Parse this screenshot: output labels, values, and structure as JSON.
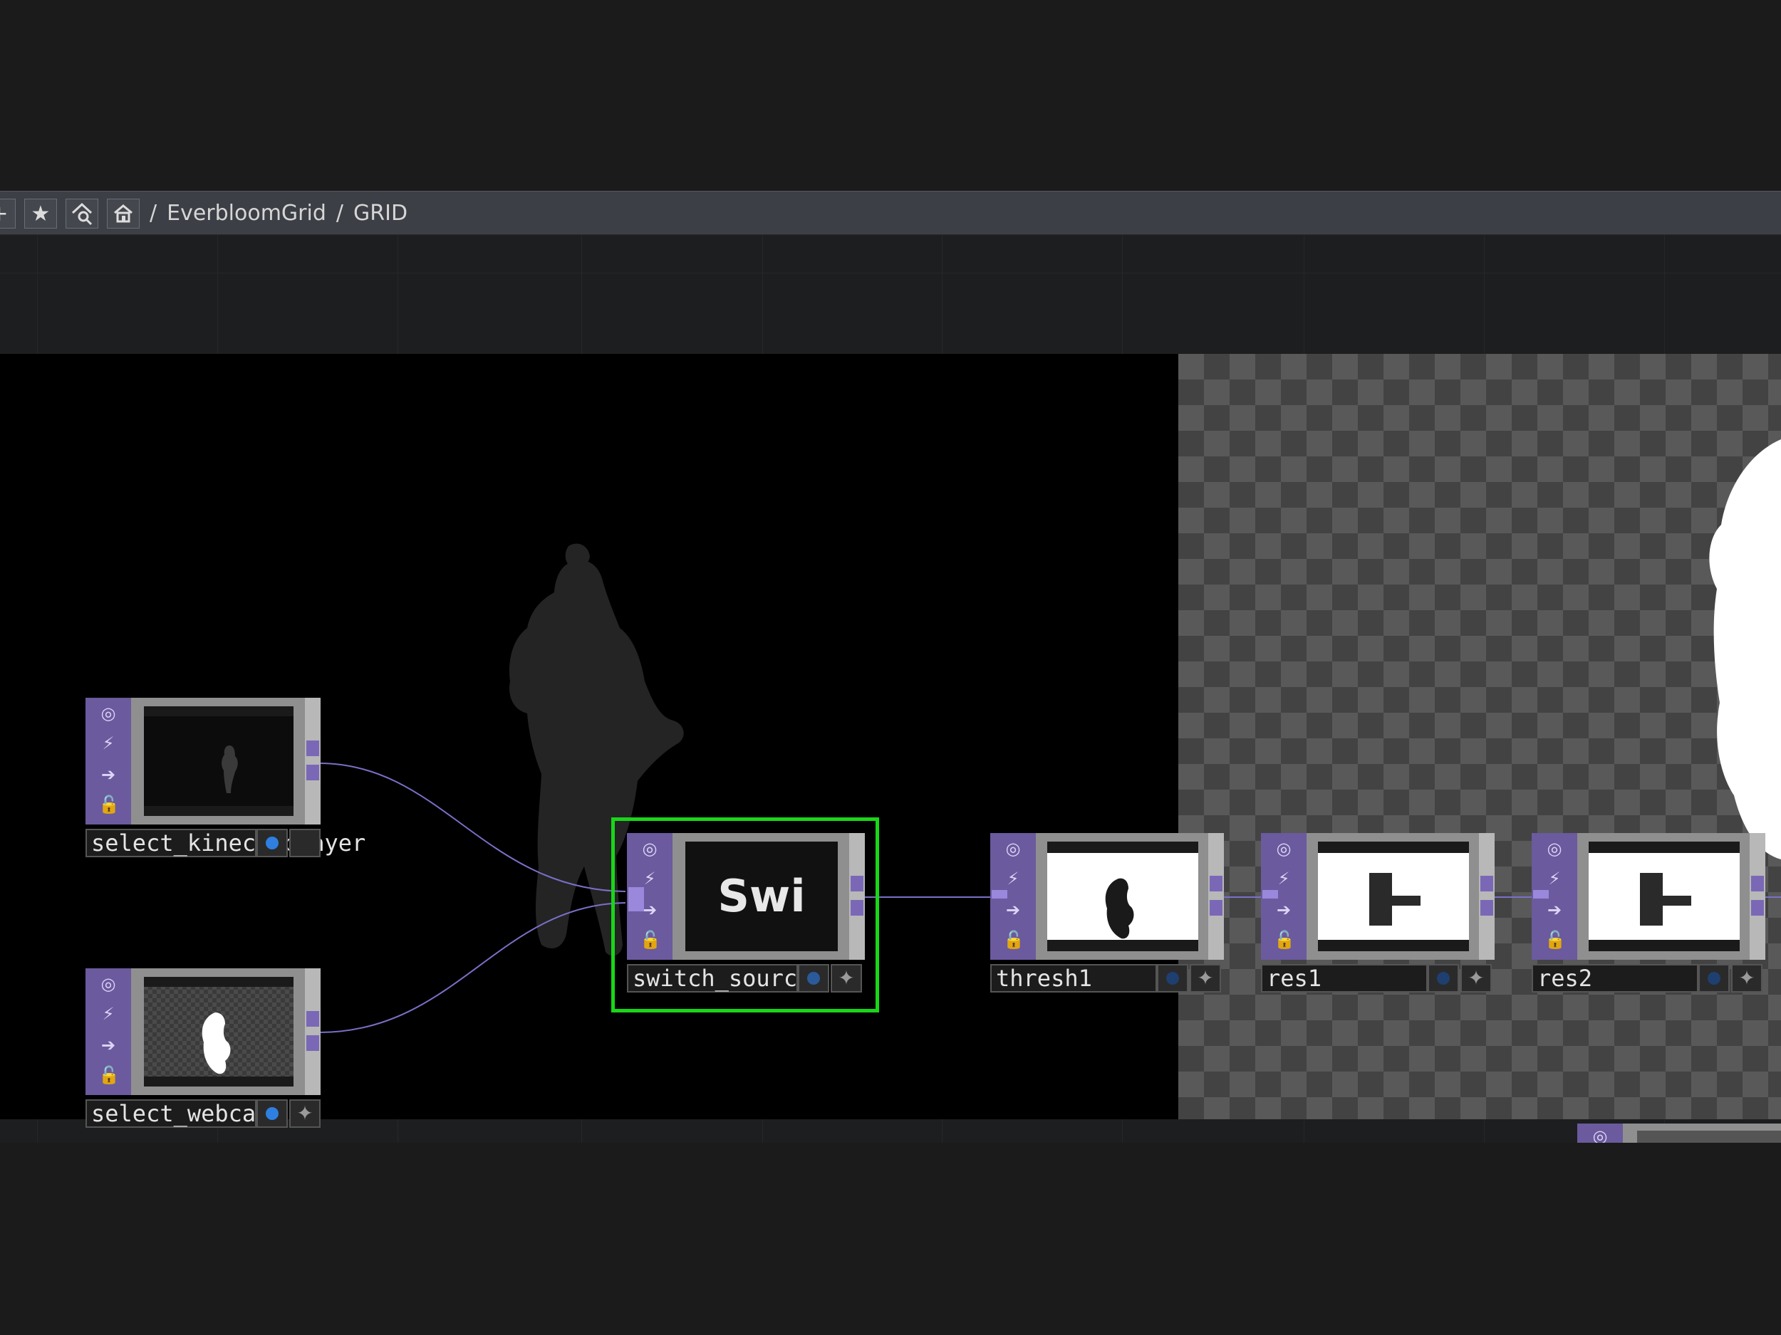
{
  "toolbar": {
    "breadcrumb": [
      "/",
      "EverbloomGrid",
      "/",
      "GRID"
    ],
    "buttons": [
      "plus-icon",
      "star-icon",
      "search-network-icon",
      "home-icon"
    ]
  },
  "nodes": {
    "select_kinect_player": {
      "label": "select_kinect_player"
    },
    "select_webcam": {
      "label": "select_webcam"
    },
    "switch_source": {
      "label": "switch_source",
      "preview_text": "Swi"
    },
    "thresh1": {
      "label": "thresh1"
    },
    "res1": {
      "label": "res1"
    },
    "res2": {
      "label": "res2"
    }
  },
  "colors": {
    "selection": "#19d619",
    "operator_strip": "#6b5a9e",
    "viewer_active_dot": "#2e7fe0"
  }
}
